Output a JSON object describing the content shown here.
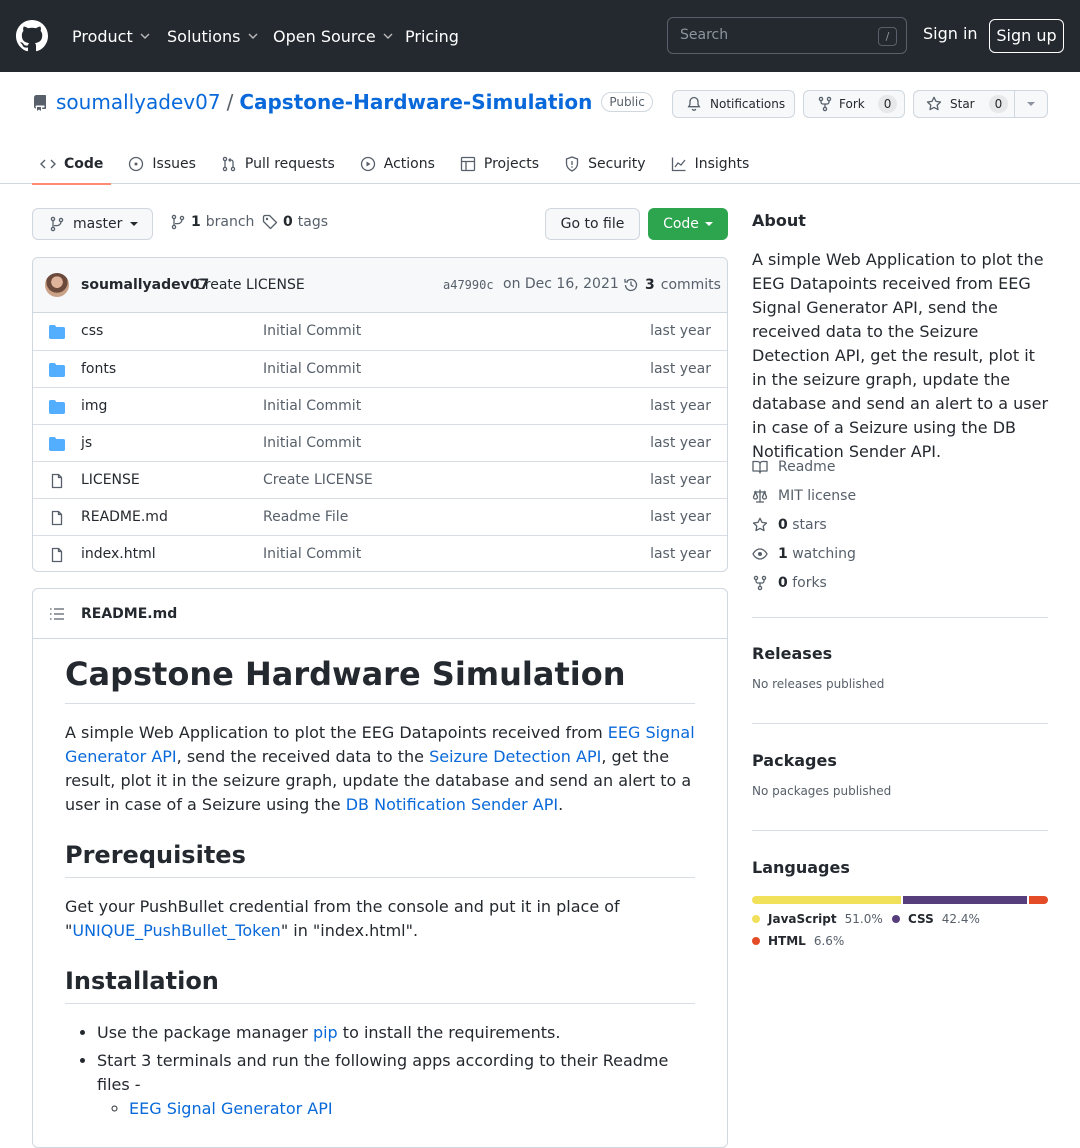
{
  "header": {
    "nav": [
      "Product",
      "Solutions",
      "Open Source",
      "Pricing"
    ],
    "search_placeholder": "Search",
    "search_shortcut": "/",
    "sign_in": "Sign in",
    "sign_up": "Sign up"
  },
  "repo": {
    "owner": "soumallyadev07",
    "separator": "/",
    "name": "Capstone-Hardware-Simulation",
    "visibility": "Public",
    "notifications_label": "Notifications",
    "fork_label": "Fork",
    "fork_count": "0",
    "star_label": "Star",
    "star_count": "0"
  },
  "tabs": [
    "Code",
    "Issues",
    "Pull requests",
    "Actions",
    "Projects",
    "Security",
    "Insights"
  ],
  "toolbar": {
    "branch": "master",
    "branch_count": "1",
    "branch_label": "branch",
    "tag_count": "0",
    "tag_label": "tags",
    "go_to_file": "Go to file",
    "code": "Code"
  },
  "commit": {
    "author": "soumallyadev07",
    "message": "Create LICENSE",
    "sha": "a47990c",
    "date": "on Dec 16, 2021",
    "count": "3",
    "count_label": "commits"
  },
  "files": [
    {
      "type": "dir",
      "name": "css",
      "message": "Initial Commit",
      "age": "last year"
    },
    {
      "type": "dir",
      "name": "fonts",
      "message": "Initial Commit",
      "age": "last year"
    },
    {
      "type": "dir",
      "name": "img",
      "message": "Initial Commit",
      "age": "last year"
    },
    {
      "type": "dir",
      "name": "js",
      "message": "Initial Commit",
      "age": "last year"
    },
    {
      "type": "file",
      "name": "LICENSE",
      "message": "Create LICENSE",
      "age": "last year"
    },
    {
      "type": "file",
      "name": "README.md",
      "message": "Readme File",
      "age": "last year"
    },
    {
      "type": "file",
      "name": "index.html",
      "message": "Initial Commit",
      "age": "last year"
    }
  ],
  "readme": {
    "filename": "README.md",
    "title": "Capstone Hardware Simulation",
    "intro": {
      "t1": "A simple Web Application to plot the EEG Datapoints received from ",
      "l1": "EEG Signal Generator API",
      "t2": ", send the received data to the ",
      "l2": "Seizure Detection API",
      "t3": ", get the result, plot it in the seizure graph, update the database and send an alert to a user in case of a Seizure using the ",
      "l3": "DB Notification Sender API",
      "t4": "."
    },
    "prereq_heading": "Prerequisites",
    "prereq": {
      "t1": "Get your PushBullet credential from the console and put it in place of \"",
      "l1": "UNIQUE_PushBullet_Token",
      "t2": "\" in \"index.html\"."
    },
    "install_heading": "Installation",
    "install": {
      "i1a": "Use the package manager ",
      "i1l": "pip",
      "i1b": " to install the requirements.",
      "i2": "Start 3 terminals and run the following apps according to their Readme files -",
      "i3l": "EEG Signal Generator API"
    }
  },
  "about": {
    "heading": "About",
    "description": "A simple Web Application to plot the EEG Datapoints received from EEG Signal Generator API, send the received data to the Seizure Detection API, get the result, plot it in the seizure graph, update the database and send an alert to a user in case of a Seizure using the DB Notification Sender API.",
    "readme": "Readme",
    "license": "MIT license",
    "stars_count": "0",
    "stars_label": "stars",
    "watching_count": "1",
    "watching_label": "watching",
    "forks_count": "0",
    "forks_label": "forks"
  },
  "releases": {
    "heading": "Releases",
    "text": "No releases published"
  },
  "packages": {
    "heading": "Packages",
    "text": "No packages published"
  },
  "languages": {
    "heading": "Languages",
    "items": [
      {
        "name": "JavaScript",
        "percent": "51.0%",
        "value": 51.0,
        "color": "#f1e05a"
      },
      {
        "name": "CSS",
        "percent": "42.4%",
        "value": 42.4,
        "color": "#563d7c"
      },
      {
        "name": "HTML",
        "percent": "6.6%",
        "value": 6.6,
        "color": "#e34c26"
      }
    ]
  }
}
